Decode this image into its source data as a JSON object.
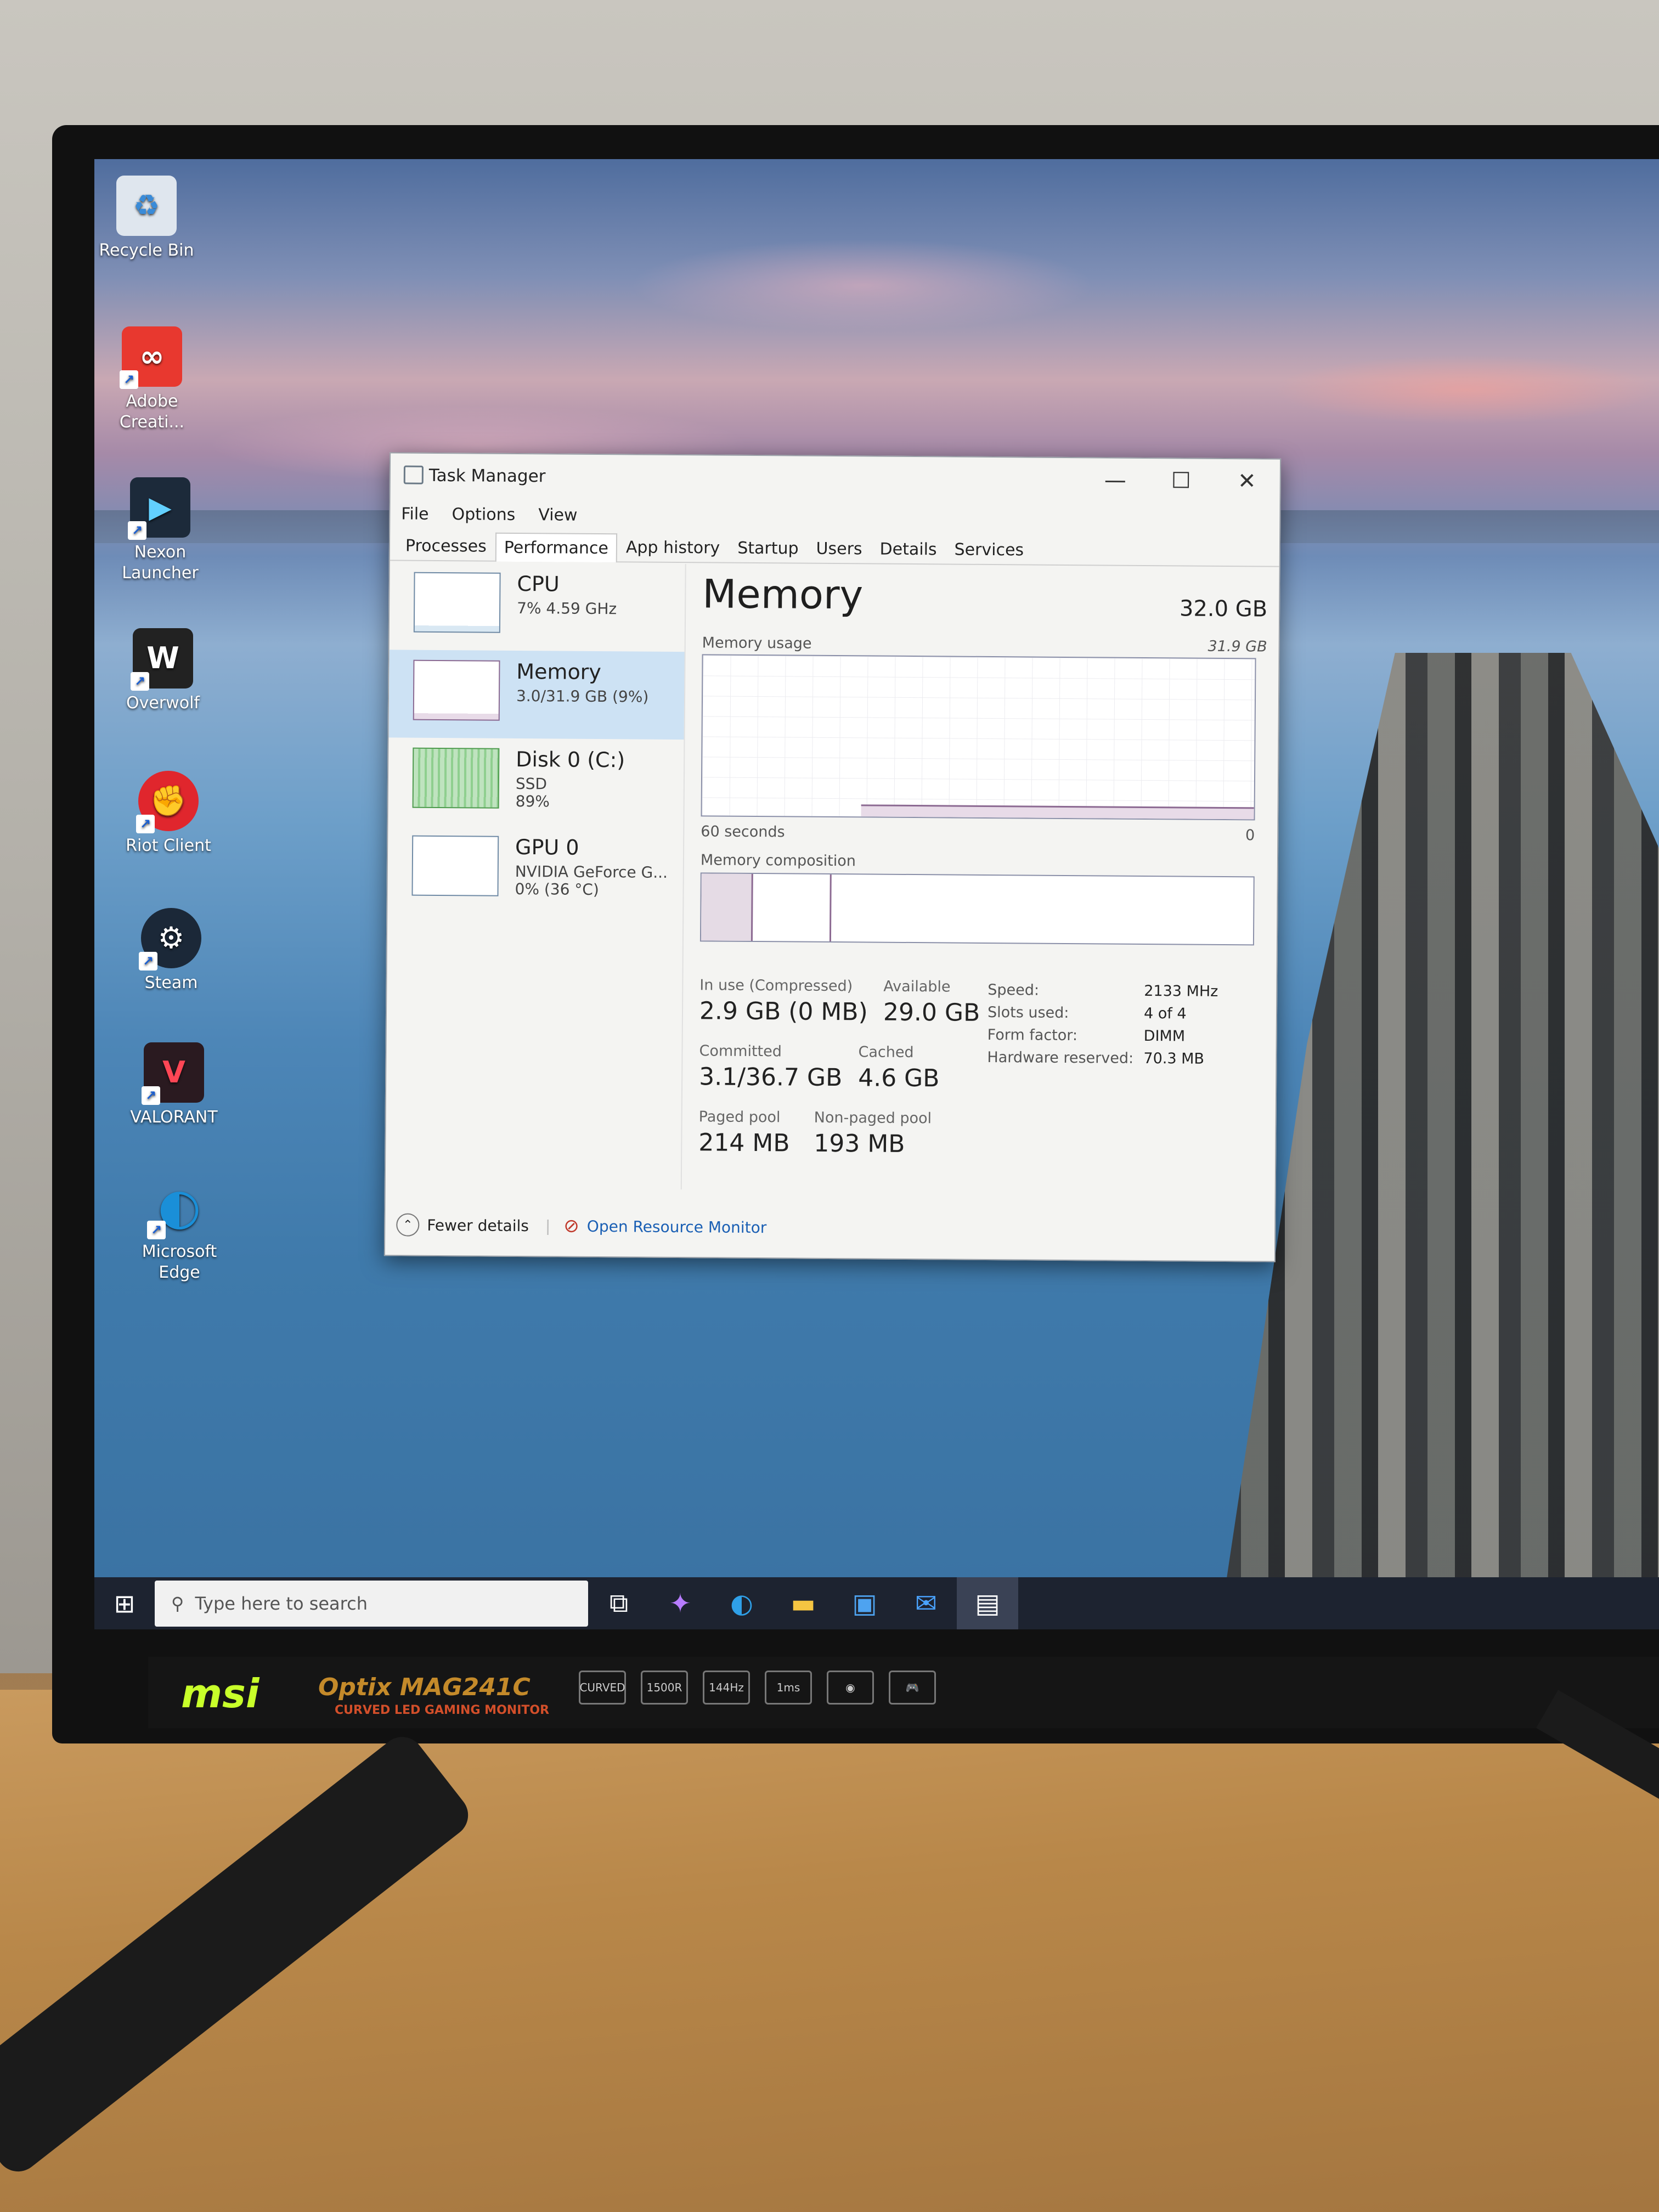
{
  "desktop": {
    "icons": [
      {
        "label": "Recycle Bin",
        "icon": "recycle-bin-icon",
        "color": "#dfe6ee"
      },
      {
        "label": "Adobe Creati...",
        "icon": "adobe-creative-cloud-icon",
        "color": "#e8382f"
      },
      {
        "label": "Nexon Launcher",
        "icon": "nexon-launcher-icon",
        "color": "#1c2a3a"
      },
      {
        "label": "Overwolf",
        "icon": "overwolf-icon",
        "color": "#222222"
      },
      {
        "label": "Riot Client",
        "icon": "riot-client-icon",
        "color": "#e0262d"
      },
      {
        "label": "Steam",
        "icon": "steam-icon",
        "color": "#1b2838"
      },
      {
        "label": "VALORANT",
        "icon": "valorant-icon",
        "color": "#ff4655"
      },
      {
        "label": "Microsoft Edge",
        "icon": "edge-icon",
        "color": "#1a8fd8"
      }
    ]
  },
  "task_manager": {
    "title": "Task Manager",
    "menu": [
      "File",
      "Options",
      "View"
    ],
    "tabs": [
      "Processes",
      "Performance",
      "App history",
      "Startup",
      "Users",
      "Details",
      "Services"
    ],
    "active_tab": "Performance",
    "resources": [
      {
        "name": "CPU",
        "line1": "7% 4.59 GHz",
        "line2": ""
      },
      {
        "name": "Memory",
        "line1": "3.0/31.9 GB (9%)",
        "line2": ""
      },
      {
        "name": "Disk 0 (C:)",
        "line1": "SSD",
        "line2": "89%"
      },
      {
        "name": "GPU 0",
        "line1": "NVIDIA GeForce G...",
        "line2": "0% (36 °C)"
      }
    ],
    "memory": {
      "heading": "Memory",
      "total": "32.0 GB",
      "usage_label": "Memory usage",
      "usage_max": "31.9 GB",
      "time_left": "60 seconds",
      "time_right": "0",
      "composition_label": "Memory composition",
      "in_use_label": "In use (Compressed)",
      "in_use_value": "2.9 GB (0 MB)",
      "available_label": "Available",
      "available_value": "29.0 GB",
      "committed_label": "Committed",
      "committed_value": "3.1/36.7 GB",
      "cached_label": "Cached",
      "cached_value": "4.6 GB",
      "paged_label": "Paged pool",
      "paged_value": "214 MB",
      "nonpaged_label": "Non-paged pool",
      "nonpaged_value": "193 MB",
      "speed_label": "Speed:",
      "speed_value": "2133 MHz",
      "slots_label": "Slots used:",
      "slots_value": "4 of 4",
      "form_label": "Form factor:",
      "form_value": "DIMM",
      "hw_label": "Hardware reserved:",
      "hw_value": "70.3 MB"
    },
    "footer": {
      "fewer_details": "Fewer details",
      "open_resource_monitor": "Open Resource Monitor"
    }
  },
  "taskbar": {
    "search_placeholder": "Type here to search"
  },
  "monitor": {
    "brand": "msi",
    "model": "Optix MAG241C",
    "subtitle": "CURVED LED GAMING MONITOR",
    "badges": [
      "CURVED",
      "1500R",
      "144Hz",
      "1ms",
      "",
      ""
    ]
  }
}
